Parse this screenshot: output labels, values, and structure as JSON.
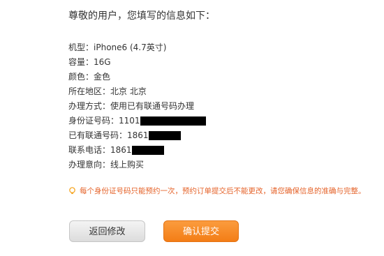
{
  "heading": "尊敬的用户，您填写的信息如下：",
  "info": [
    {
      "label": "机型",
      "value": "iPhone6 (4.7英寸)"
    },
    {
      "label": "容量",
      "value": "16G"
    },
    {
      "label": "颜色",
      "value": "金色"
    },
    {
      "label": "所在地区",
      "value": "北京 北京"
    },
    {
      "label": "办理方式",
      "value": "使用已有联通号码办理"
    },
    {
      "label": "身份证号码",
      "value": "1101",
      "redacted": true
    },
    {
      "label": "已有联通号码",
      "value": "1861",
      "redacted": true
    },
    {
      "label": "联系电话",
      "value": "1861",
      "redacted": true
    },
    {
      "label": "办理意向",
      "value": "线上购买"
    }
  ],
  "notice": "每个身份证号码只能预约一次，预约订单提交后不能更改，请您确保信息的准确与完整。",
  "buttons": {
    "back": "返回修改",
    "submit": "确认提交"
  },
  "colors": {
    "accent": "#f37d16",
    "notice": "#e5632a"
  },
  "icons": {
    "notice": "lightbulb-icon"
  }
}
